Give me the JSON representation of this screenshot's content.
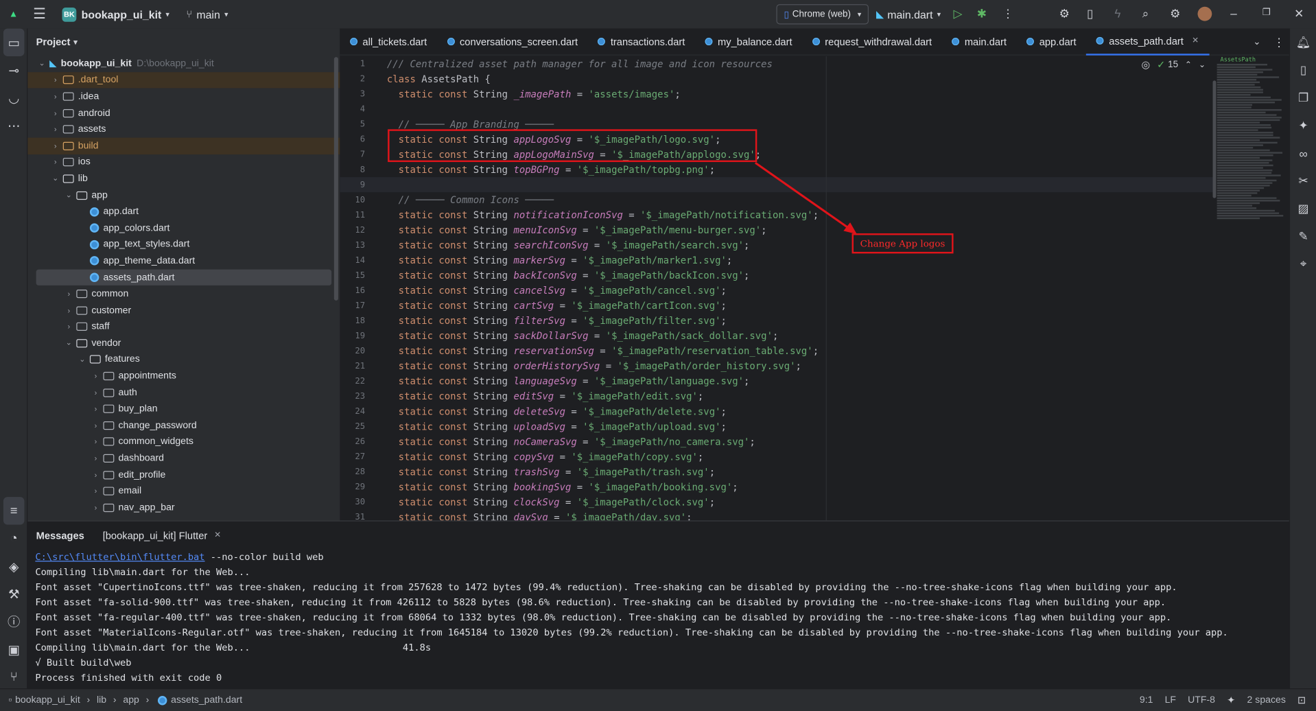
{
  "titlebar": {
    "project_badge": "BK",
    "project_name": "bookapp_ui_kit",
    "branch": "main",
    "device": "Chrome (web)",
    "run_config": "main.dart"
  },
  "project_panel": {
    "title": "Project",
    "tree": [
      {
        "label": "bookapp_ui_kit",
        "path": "D:\\bookapp_ui_kit",
        "level": 0,
        "type": "root",
        "open": true
      },
      {
        "label": ".dart_tool",
        "level": 1,
        "type": "folder",
        "state": "excluded"
      },
      {
        "label": ".idea",
        "level": 1,
        "type": "folder"
      },
      {
        "label": "android",
        "level": 1,
        "type": "folder"
      },
      {
        "label": "assets",
        "level": 1,
        "type": "folder"
      },
      {
        "label": "build",
        "level": 1,
        "type": "folder",
        "state": "excluded"
      },
      {
        "label": "ios",
        "level": 1,
        "type": "folder"
      },
      {
        "label": "lib",
        "level": 1,
        "type": "folder",
        "open": true
      },
      {
        "label": "app",
        "level": 2,
        "type": "folder",
        "open": true
      },
      {
        "label": "app.dart",
        "level": 3,
        "type": "dart"
      },
      {
        "label": "app_colors.dart",
        "level": 3,
        "type": "dart"
      },
      {
        "label": "app_text_styles.dart",
        "level": 3,
        "type": "dart"
      },
      {
        "label": "app_theme_data.dart",
        "level": 3,
        "type": "dart"
      },
      {
        "label": "assets_path.dart",
        "level": 3,
        "type": "dart",
        "selected": true
      },
      {
        "label": "common",
        "level": 2,
        "type": "folder"
      },
      {
        "label": "customer",
        "level": 2,
        "type": "folder"
      },
      {
        "label": "staff",
        "level": 2,
        "type": "folder"
      },
      {
        "label": "vendor",
        "level": 2,
        "type": "folder",
        "open": true
      },
      {
        "label": "features",
        "level": 3,
        "type": "folder",
        "open": true
      },
      {
        "label": "appointments",
        "level": 4,
        "type": "folder"
      },
      {
        "label": "auth",
        "level": 4,
        "type": "folder"
      },
      {
        "label": "buy_plan",
        "level": 4,
        "type": "folder"
      },
      {
        "label": "change_password",
        "level": 4,
        "type": "folder"
      },
      {
        "label": "common_widgets",
        "level": 4,
        "type": "folder"
      },
      {
        "label": "dashboard",
        "level": 4,
        "type": "folder"
      },
      {
        "label": "edit_profile",
        "level": 4,
        "type": "folder"
      },
      {
        "label": "email",
        "level": 4,
        "type": "folder"
      },
      {
        "label": "nav_app_bar",
        "level": 4,
        "type": "folder"
      }
    ]
  },
  "editor": {
    "tabs": [
      "all_tickets.dart",
      "conversations_screen.dart",
      "transactions.dart",
      "my_balance.dart",
      "request_withdrawal.dart",
      "main.dart",
      "app.dart",
      "assets_path.dart"
    ],
    "active_tab": "assets_path.dart",
    "problems_count": "15",
    "minimap_label": "AssetsPath",
    "code_lines": [
      [
        [
          "c",
          "/// Centralized asset path manager for all image and icon resources"
        ]
      ],
      [
        [
          "k",
          "class "
        ],
        [
          "cls",
          "AssetsPath {"
        ]
      ],
      [
        [
          "t",
          "  "
        ],
        [
          "k",
          "static const "
        ],
        [
          "t",
          "String "
        ],
        [
          "v",
          "_imagePath"
        ],
        [
          "t",
          " = "
        ],
        [
          "s",
          "'assets/images'"
        ],
        [
          "t",
          ";"
        ]
      ],
      [],
      [
        [
          "c",
          "  // ───── App Branding ─────"
        ]
      ],
      [
        [
          "t",
          "  "
        ],
        [
          "k",
          "static const "
        ],
        [
          "t",
          "String "
        ],
        [
          "v",
          "appLogoSvg"
        ],
        [
          "t",
          " = "
        ],
        [
          "s",
          "'$_imagePath/logo.svg'"
        ],
        [
          "t",
          ";"
        ]
      ],
      [
        [
          "t",
          "  "
        ],
        [
          "k",
          "static const "
        ],
        [
          "t",
          "String "
        ],
        [
          "v",
          "appLogoMainSvg"
        ],
        [
          "t",
          " = "
        ],
        [
          "s",
          "'$_imagePath/applogo.svg'"
        ],
        [
          "t",
          ";"
        ]
      ],
      [
        [
          "t",
          "  "
        ],
        [
          "k",
          "static const "
        ],
        [
          "t",
          "String "
        ],
        [
          "v",
          "topBGPng"
        ],
        [
          "t",
          " = "
        ],
        [
          "s",
          "'$_imagePath/topbg.png'"
        ],
        [
          "t",
          ";"
        ]
      ],
      [],
      [
        [
          "c",
          "  // ───── Common Icons ─────"
        ]
      ],
      [
        [
          "t",
          "  "
        ],
        [
          "k",
          "static const "
        ],
        [
          "t",
          "String "
        ],
        [
          "v",
          "notificationIconSvg"
        ],
        [
          "t",
          " = "
        ],
        [
          "s",
          "'$_imagePath/notification.svg'"
        ],
        [
          "t",
          ";"
        ]
      ],
      [
        [
          "t",
          "  "
        ],
        [
          "k",
          "static const "
        ],
        [
          "t",
          "String "
        ],
        [
          "v",
          "menuIconSvg"
        ],
        [
          "t",
          " = "
        ],
        [
          "s",
          "'$_imagePath/menu-burger.svg'"
        ],
        [
          "t",
          ";"
        ]
      ],
      [
        [
          "t",
          "  "
        ],
        [
          "k",
          "static const "
        ],
        [
          "t",
          "String "
        ],
        [
          "v",
          "searchIconSvg"
        ],
        [
          "t",
          " = "
        ],
        [
          "s",
          "'$_imagePath/search.svg'"
        ],
        [
          "t",
          ";"
        ]
      ],
      [
        [
          "t",
          "  "
        ],
        [
          "k",
          "static const "
        ],
        [
          "t",
          "String "
        ],
        [
          "v",
          "markerSvg"
        ],
        [
          "t",
          " = "
        ],
        [
          "s",
          "'$_imagePath/marker1.svg'"
        ],
        [
          "t",
          ";"
        ]
      ],
      [
        [
          "t",
          "  "
        ],
        [
          "k",
          "static const "
        ],
        [
          "t",
          "String "
        ],
        [
          "v",
          "backIconSvg"
        ],
        [
          "t",
          " = "
        ],
        [
          "s",
          "'$_imagePath/backIcon.svg'"
        ],
        [
          "t",
          ";"
        ]
      ],
      [
        [
          "t",
          "  "
        ],
        [
          "k",
          "static const "
        ],
        [
          "t",
          "String "
        ],
        [
          "v",
          "cancelSvg"
        ],
        [
          "t",
          " = "
        ],
        [
          "s",
          "'$_imagePath/cancel.svg'"
        ],
        [
          "t",
          ";"
        ]
      ],
      [
        [
          "t",
          "  "
        ],
        [
          "k",
          "static const "
        ],
        [
          "t",
          "String "
        ],
        [
          "v",
          "cartSvg"
        ],
        [
          "t",
          " = "
        ],
        [
          "s",
          "'$_imagePath/cartIcon.svg'"
        ],
        [
          "t",
          ";"
        ]
      ],
      [
        [
          "t",
          "  "
        ],
        [
          "k",
          "static const "
        ],
        [
          "t",
          "String "
        ],
        [
          "v",
          "filterSvg"
        ],
        [
          "t",
          " = "
        ],
        [
          "s",
          "'$_imagePath/filter.svg'"
        ],
        [
          "t",
          ";"
        ]
      ],
      [
        [
          "t",
          "  "
        ],
        [
          "k",
          "static const "
        ],
        [
          "t",
          "String "
        ],
        [
          "v",
          "sackDollarSvg"
        ],
        [
          "t",
          " = "
        ],
        [
          "s",
          "'$_imagePath/sack_dollar.svg'"
        ],
        [
          "t",
          ";"
        ]
      ],
      [
        [
          "t",
          "  "
        ],
        [
          "k",
          "static const "
        ],
        [
          "t",
          "String "
        ],
        [
          "v",
          "reservationSvg"
        ],
        [
          "t",
          " = "
        ],
        [
          "s",
          "'$_imagePath/reservation_table.svg'"
        ],
        [
          "t",
          ";"
        ]
      ],
      [
        [
          "t",
          "  "
        ],
        [
          "k",
          "static const "
        ],
        [
          "t",
          "String "
        ],
        [
          "v",
          "orderHistorySvg"
        ],
        [
          "t",
          " = "
        ],
        [
          "s",
          "'$_imagePath/order_history.svg'"
        ],
        [
          "t",
          ";"
        ]
      ],
      [
        [
          "t",
          "  "
        ],
        [
          "k",
          "static const "
        ],
        [
          "t",
          "String "
        ],
        [
          "v",
          "languageSvg"
        ],
        [
          "t",
          " = "
        ],
        [
          "s",
          "'$_imagePath/language.svg'"
        ],
        [
          "t",
          ";"
        ]
      ],
      [
        [
          "t",
          "  "
        ],
        [
          "k",
          "static const "
        ],
        [
          "t",
          "String "
        ],
        [
          "v",
          "editSvg"
        ],
        [
          "t",
          " = "
        ],
        [
          "s",
          "'$_imagePath/edit.svg'"
        ],
        [
          "t",
          ";"
        ]
      ],
      [
        [
          "t",
          "  "
        ],
        [
          "k",
          "static const "
        ],
        [
          "t",
          "String "
        ],
        [
          "v",
          "deleteSvg"
        ],
        [
          "t",
          " = "
        ],
        [
          "s",
          "'$_imagePath/delete.svg'"
        ],
        [
          "t",
          ";"
        ]
      ],
      [
        [
          "t",
          "  "
        ],
        [
          "k",
          "static const "
        ],
        [
          "t",
          "String "
        ],
        [
          "v",
          "uploadSvg"
        ],
        [
          "t",
          " = "
        ],
        [
          "s",
          "'$_imagePath/upload.svg'"
        ],
        [
          "t",
          ";"
        ]
      ],
      [
        [
          "t",
          "  "
        ],
        [
          "k",
          "static const "
        ],
        [
          "t",
          "String "
        ],
        [
          "v",
          "noCameraSvg"
        ],
        [
          "t",
          " = "
        ],
        [
          "s",
          "'$_imagePath/no_camera.svg'"
        ],
        [
          "t",
          ";"
        ]
      ],
      [
        [
          "t",
          "  "
        ],
        [
          "k",
          "static const "
        ],
        [
          "t",
          "String "
        ],
        [
          "v",
          "copySvg"
        ],
        [
          "t",
          " = "
        ],
        [
          "s",
          "'$_imagePath/copy.svg'"
        ],
        [
          "t",
          ";"
        ]
      ],
      [
        [
          "t",
          "  "
        ],
        [
          "k",
          "static const "
        ],
        [
          "t",
          "String "
        ],
        [
          "v",
          "trashSvg"
        ],
        [
          "t",
          " = "
        ],
        [
          "s",
          "'$_imagePath/trash.svg'"
        ],
        [
          "t",
          ";"
        ]
      ],
      [
        [
          "t",
          "  "
        ],
        [
          "k",
          "static const "
        ],
        [
          "t",
          "String "
        ],
        [
          "v",
          "bookingSvg"
        ],
        [
          "t",
          " = "
        ],
        [
          "s",
          "'$_imagePath/booking.svg'"
        ],
        [
          "t",
          ";"
        ]
      ],
      [
        [
          "t",
          "  "
        ],
        [
          "k",
          "static const "
        ],
        [
          "t",
          "String "
        ],
        [
          "v",
          "clockSvg"
        ],
        [
          "t",
          " = "
        ],
        [
          "s",
          "'$_imagePath/clock.svg'"
        ],
        [
          "t",
          ";"
        ]
      ],
      [
        [
          "t",
          "  "
        ],
        [
          "k",
          "static const "
        ],
        [
          "t",
          "String "
        ],
        [
          "v",
          "daySvg"
        ],
        [
          "t",
          " = "
        ],
        [
          "s",
          "'$_imagePath/day.svg'"
        ],
        [
          "t",
          ";"
        ]
      ]
    ],
    "annotation": "Change App logos"
  },
  "messages": {
    "tab_messages": "Messages",
    "tab_flutter": "[bookapp_ui_kit] Flutter",
    "cmd_link": "C:\\src\\flutter\\bin\\flutter.bat",
    "cmd_args": " --no-color build web",
    "lines": [
      "Compiling lib\\main.dart for the Web...",
      "Font asset \"CupertinoIcons.ttf\" was tree-shaken, reducing it from 257628 to 1472 bytes (99.4% reduction). Tree-shaking can be disabled by providing the --no-tree-shake-icons flag when building your app.",
      "Font asset \"fa-solid-900.ttf\" was tree-shaken, reducing it from 426112 to 5828 bytes (98.6% reduction). Tree-shaking can be disabled by providing the --no-tree-shake-icons flag when building your app.",
      "Font asset \"fa-regular-400.ttf\" was tree-shaken, reducing it from 68064 to 1332 bytes (98.0% reduction). Tree-shaking can be disabled by providing the --no-tree-shake-icons flag when building your app.",
      "Font asset \"MaterialIcons-Regular.otf\" was tree-shaken, reducing it from 1645184 to 13020 bytes (99.2% reduction). Tree-shaking can be disabled by providing the --no-tree-shake-icons flag when building your app.",
      "Compiling lib\\main.dart for the Web...                           41.8s",
      "√ Built build\\web",
      "Process finished with exit code 0"
    ]
  },
  "statusbar": {
    "breadcrumb": [
      "bookapp_ui_kit",
      "lib",
      "app",
      "assets_path.dart"
    ],
    "position": "9:1",
    "line_sep": "LF",
    "encoding": "UTF-8",
    "indent": "2 spaces"
  },
  "colors": {
    "accent": "#3574f0",
    "annotation_red": "#e0141a",
    "keyword": "#cf8e6d",
    "string": "#6aab73",
    "field": "#c77dbb"
  }
}
